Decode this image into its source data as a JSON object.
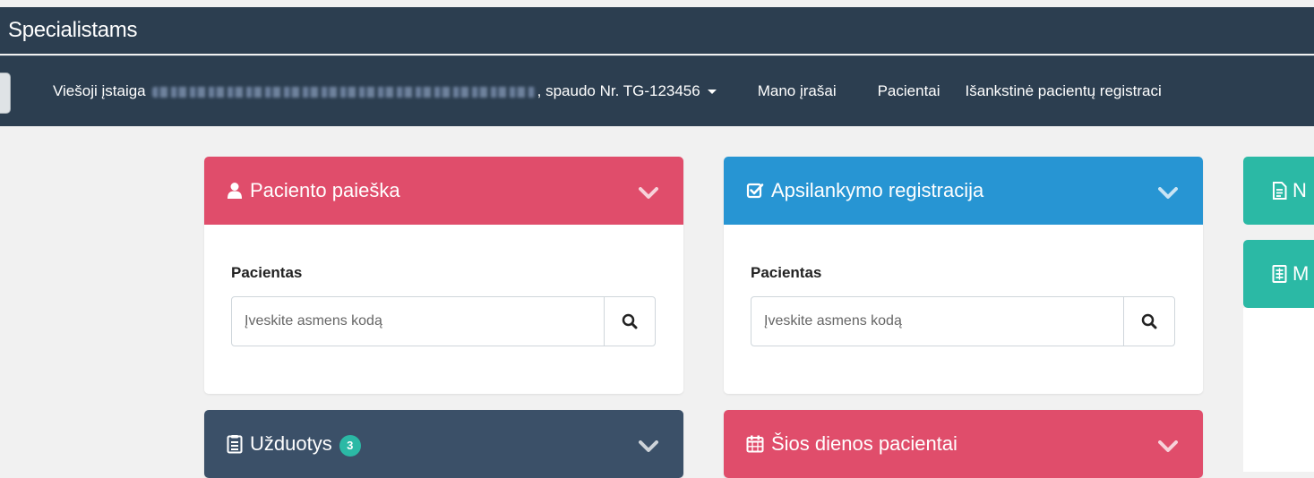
{
  "app": {
    "title": "Specialistams"
  },
  "nav": {
    "institution_prefix": "Viešoji įstaiga",
    "institution_suffix": ", spaudo Nr. TG-123456",
    "items": [
      "Mano įrašai",
      "Pacientai",
      "Išankstinė pacientų registraci"
    ]
  },
  "panels": {
    "patient_search": {
      "title": "Paciento paieška",
      "field_label": "Pacientas",
      "placeholder": "Įveskite asmens kodą",
      "icon": "user-icon"
    },
    "visit_registration": {
      "title": "Apsilankymo registracija",
      "field_label": "Pacientas",
      "placeholder": "Įveskite asmens kodą",
      "icon": "check-square-icon"
    },
    "tasks": {
      "title": "Užduotys",
      "badge": "3",
      "icon": "clipboard-icon"
    },
    "todays_patients": {
      "title": "Šios dienos pacientai",
      "icon": "calendar-icon"
    }
  },
  "side_tiles": [
    {
      "label": "N",
      "icon": "document-icon"
    },
    {
      "label": "M",
      "icon": "list-document-icon"
    }
  ],
  "colors": {
    "topbar": "#2c3e50",
    "red": "#e04d6b",
    "blue": "#2795d3",
    "dark": "#3b5068",
    "teal": "#2bb9a5",
    "background": "#f1f1f1"
  }
}
